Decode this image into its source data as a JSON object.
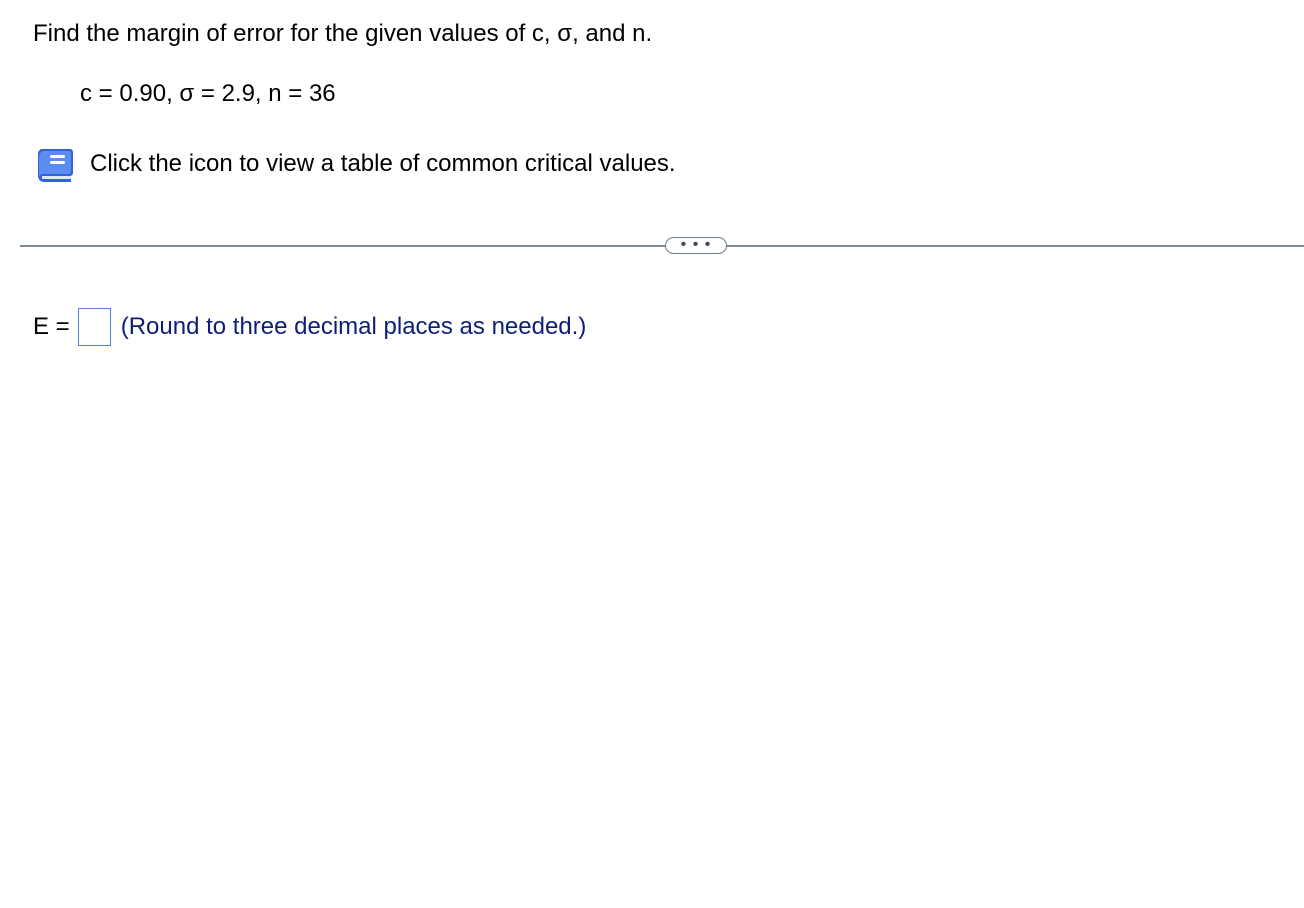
{
  "question": {
    "text": "Find the margin of error for the given values of c, σ, and n."
  },
  "given": {
    "text": "c = 0.90, σ = 2.9, n = 36"
  },
  "resource": {
    "icon": "book-icon",
    "text": "Click the icon to view a table of common critical values."
  },
  "more_button": {
    "label": "• • •"
  },
  "answer": {
    "label": "E =",
    "value": "",
    "hint": "(Round to three decimal places as needed.)"
  },
  "colors": {
    "hint_text": "#0c1e7a",
    "input_border": "#5a7fc6",
    "divider": "#7f8a96",
    "icon_blue": "#3a6fe0"
  }
}
